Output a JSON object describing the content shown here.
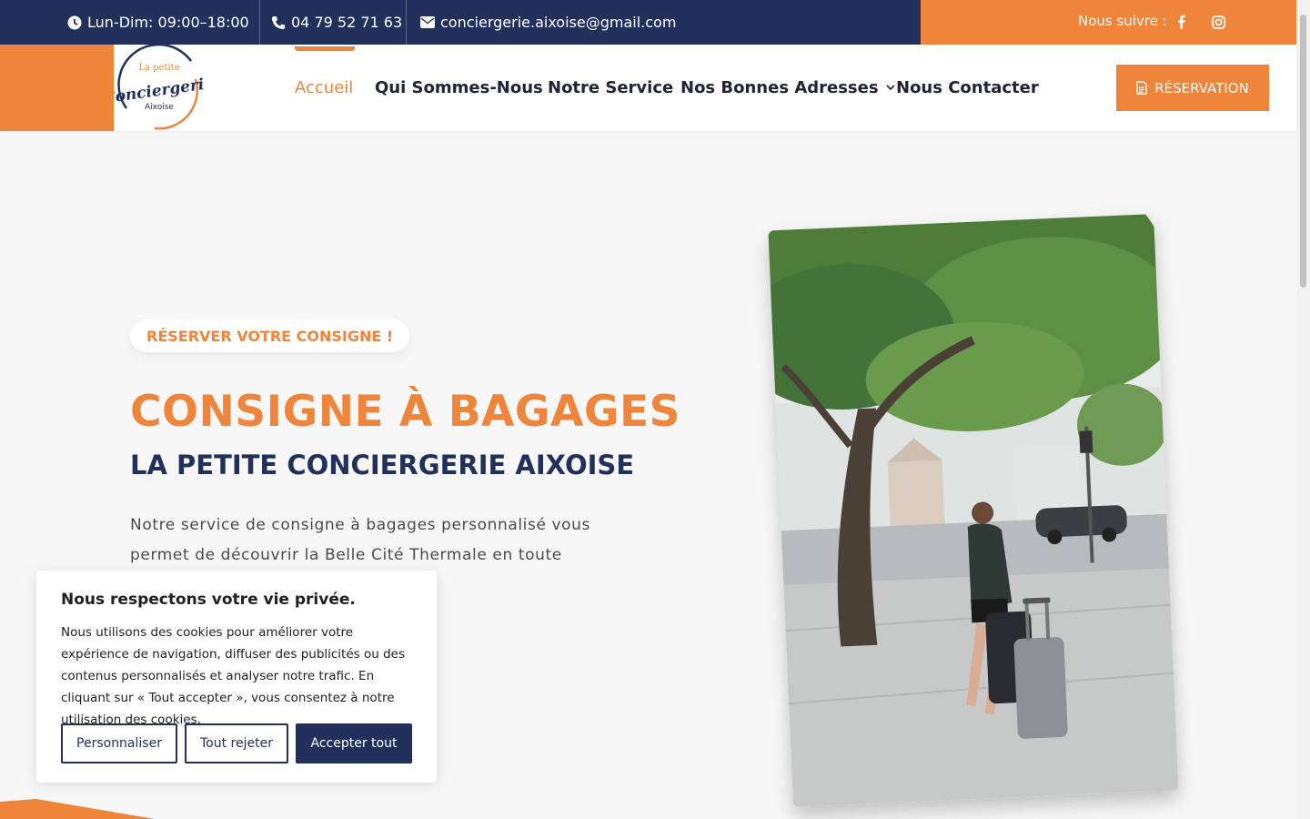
{
  "topbar": {
    "hours": "Lun-Dim: 09:00–18:00",
    "phone": "04 79 52 71 63",
    "email": "conciergerie.aixoise@gmail.com",
    "follow_label": "Nous suivre :"
  },
  "logo": {
    "line1": "La petite",
    "line2": "Conciergerie",
    "line3": "Aixoise"
  },
  "nav": {
    "home": "Accueil",
    "about": "Qui Sommes-Nous",
    "service": "Notre Service",
    "addresses": "Nos Bonnes Adresses",
    "contact": "Nous Contacter",
    "reservation": "RÉSERVATION"
  },
  "hero": {
    "pill": "RÉSERVER VOTRE CONSIGNE !",
    "title": "CONSIGNE À BAGAGES",
    "subtitle": "LA PETITE CONCIERGERIE AIXOISE",
    "text_line1": "Notre service de consigne à bagages personnalisé vous",
    "text_line2": "permet de découvrir la Belle Cité Thermale en toute"
  },
  "cookie": {
    "title": "Nous respectons votre vie privée.",
    "body": "Nous utilisons des cookies pour améliorer votre expérience de navigation, diffuser des publicités ou des contenus personnalisés et analyser notre trafic. En cliquant sur « Tout accepter », vous consentez à notre utilisation des cookies.",
    "customize": "Personnaliser",
    "reject": "Tout rejeter",
    "accept": "Accepter tout"
  },
  "colors": {
    "orange": "#ef843b",
    "navy": "#22315b"
  }
}
